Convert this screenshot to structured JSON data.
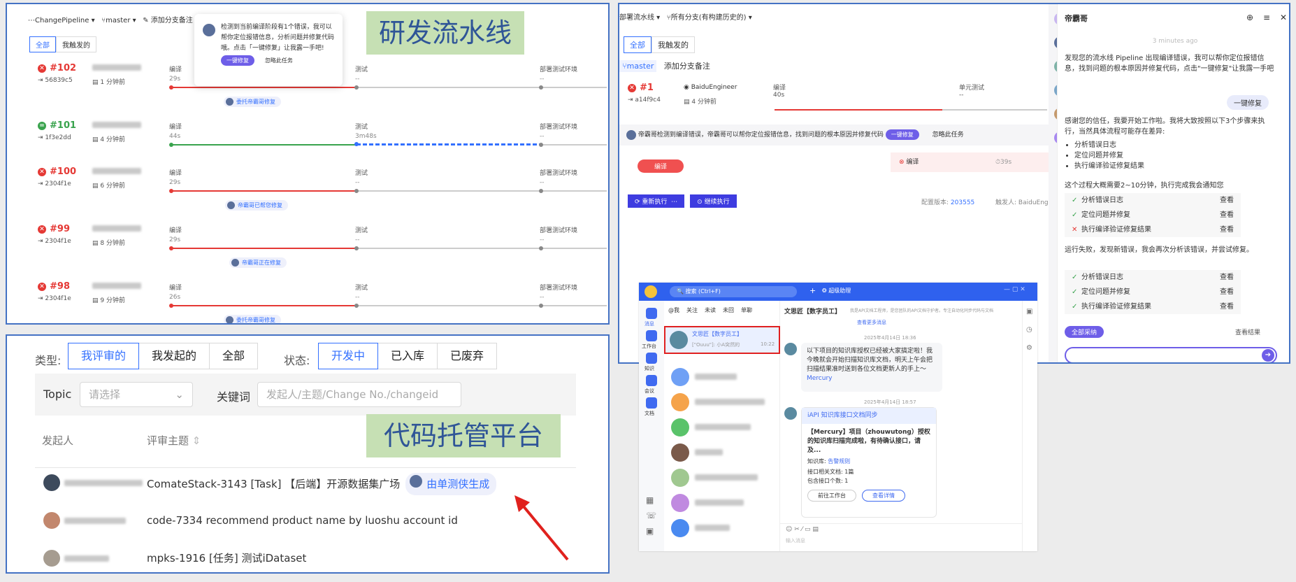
{
  "pipeline_panel": {
    "top_bar": {
      "pipeline": "ChangePipeline",
      "branch": "master",
      "add_note": "添加分支备注"
    },
    "tabs": [
      "全部",
      "我触发的"
    ],
    "popup": {
      "text": "检测到当前编译阶段有1个错误，我可以帮你定位报错信息，分析问题并修复代码哦。点击「一键修复」让我露一手吧!",
      "fix_button": "一键修复",
      "ignore": "忽略此任务"
    },
    "label": "研发流水线",
    "runs": [
      {
        "id": "#102",
        "status": "failed",
        "commit": "56839c5",
        "time": "1 分钟前",
        "stages": [
          {
            "name": "编译",
            "value": "29s"
          },
          {
            "name": "测试",
            "value": "--"
          },
          {
            "name": "部署测试环境",
            "value": "--"
          }
        ],
        "pill": "委托帝霸哥修复"
      },
      {
        "id": "#101",
        "status": "success",
        "commit": "1f3e2dd",
        "time": "4 分钟前",
        "stages": [
          {
            "name": "编译",
            "value": "44s"
          },
          {
            "name": "测试",
            "value": "3m48s"
          },
          {
            "name": "部署测试环境",
            "value": "--"
          }
        ],
        "pill": ""
      },
      {
        "id": "#100",
        "status": "failed",
        "commit": "2304f1e",
        "time": "6 分钟前",
        "stages": [
          {
            "name": "编译",
            "value": "29s"
          },
          {
            "name": "测试",
            "value": "--"
          },
          {
            "name": "部署测试环境",
            "value": "--"
          }
        ],
        "pill": "帝霸哥已帮您修复"
      },
      {
        "id": "#99",
        "status": "failed",
        "commit": "2304f1e",
        "time": "8 分钟前",
        "stages": [
          {
            "name": "编译",
            "value": "29s"
          },
          {
            "name": "测试",
            "value": "--"
          },
          {
            "name": "部署测试环境",
            "value": "--"
          }
        ],
        "pill": "帝霸哥正在修复"
      },
      {
        "id": "#98",
        "status": "failed",
        "commit": "2304f1e",
        "time": "9 分钟前",
        "stages": [
          {
            "name": "编译",
            "value": "26s"
          },
          {
            "name": "测试",
            "value": "--"
          },
          {
            "name": "部署测试环境",
            "value": "--"
          }
        ],
        "pill": "委托帝霸哥修复"
      }
    ]
  },
  "review_panel": {
    "type_label": "类型:",
    "type_options": [
      "我评审的",
      "我发起的",
      "全部"
    ],
    "status_label": "状态:",
    "status_options": [
      "开发中",
      "已入库",
      "已废弃"
    ],
    "topic_label": "Topic",
    "topic_placeholder": "请选择",
    "keyword_label": "关键词",
    "keyword_placeholder": "发起人/主题/Change No./changeid",
    "col_initiator": "发起人",
    "col_subject": "评审主题",
    "label": "代码托管平台",
    "rows": [
      {
        "subject": "ComateStack-3143 [Task] 【后端】开源数据集广场",
        "tag": "由单测侠生成"
      },
      {
        "subject": "code-7334 recommend product name by luoshu account id",
        "tag": ""
      },
      {
        "subject": "mpks-1916 [任务] 测试iDataset",
        "tag": ""
      }
    ]
  },
  "agent_panel": {
    "top_bar": {
      "pipeline": "部署流水线",
      "branch_filter": "所有分支(有构建历史的)"
    },
    "tabs": [
      "全部",
      "我触发的"
    ],
    "branch": "master",
    "add_note": "添加分支备注",
    "run": {
      "id": "#1",
      "user": "BaiduEngineer",
      "commit": "a14f9c4",
      "time": "4 分钟前",
      "stage1": "编译",
      "stage1_time": "40s",
      "stage2": "单元测试",
      "stage2_value": "--"
    },
    "notice": "帝霸哥检测到编译错误，帝霸哥可以帮你定位报错信息，找到问题的根本原因并修复代码",
    "notice_fix": "一键修复",
    "notice_ignore": "忽略此任务",
    "compile_chip": "编译",
    "compile_status": "编译",
    "compile_time": "39s",
    "rerun": "重新执行",
    "continue": "继续执行",
    "config_version_label": "配置版本:",
    "config_version": "203555",
    "trigger_label": "触发人:",
    "trigger_user": "BaiduEngine",
    "chat": {
      "name": "帝霸哥",
      "time": "3 minutes ago",
      "msg1": "发现您的流水线 Pipeline 出现编译错误，我可以帮你定位报错信息，找到问题的根本原因并修复代码，点击\"一键修复\"让我露一手吧",
      "fix_button": "一键修复",
      "msg2": "感谢您的信任，我要开始工作啦。我将大致按照以下3个步骤来执行，当然具体流程可能存在差异:",
      "bullets": [
        "分析错误日志",
        "定位问题并修复",
        "执行编译验证修复结果"
      ],
      "msg3": "这个过程大概需要2~10分钟，执行完成我会通知您",
      "check1": [
        {
          "text": "分析错误日志",
          "ok": true
        },
        {
          "text": "定位问题并修复",
          "ok": true
        },
        {
          "text": "执行编译验证修复结果",
          "ok": false
        }
      ],
      "msg4": "运行失败，发现新错误，我会再次分析该错误，并尝试修复。",
      "check2": [
        {
          "text": "分析错误日志",
          "ok": true
        },
        {
          "text": "定位问题并修复",
          "ok": true
        },
        {
          "text": "执行编译验证修复结果",
          "ok": true
        }
      ],
      "see": "查看",
      "adopt_all": "全部采纳",
      "see_result": "查看结果"
    }
  },
  "im_panel": {
    "search": "搜索 (Ctrl+F)",
    "assistant": "超级助理",
    "filters": [
      "@我",
      "关注",
      "未读",
      "未回",
      "单聊"
    ],
    "nav": [
      "消息",
      "工作台",
      "知识",
      "会议",
      "文档"
    ],
    "selected_contact": "文思匠【数字员工】",
    "selected_preview": "[\"Ouuu\"]: 小A突然的",
    "selected_time": "10:22",
    "chat_title": "文思匠【数字员工】",
    "chat_desc": "我是API文档工程师，是您团队的API文档守护者。专注自动化同步代码与文档",
    "view_more": "查看更多消息",
    "date1": "2025年4月14日 18:36",
    "msg1": "以下项目的知识库授权已经被大家搞定啦！我今晚就会开始扫描知识库文档，明天上午会把扫描结果准时送到各位文档更新人的手上～",
    "msg1_author": "Mercury",
    "date2": "2025年4月14日 18:57",
    "card_title": "iAPI 知识库接口文档同步",
    "card_body": "【Mercury】项目（zhouwutong）授权的知识库扫描完成啦，有待确认接口，请及...",
    "kb_label": "知识库:",
    "kb_value": "告警规则",
    "api_docs_label": "接口相关文档:",
    "api_docs_value": "1篇",
    "api_count_label": "包含接口个数:",
    "api_count_value": "1",
    "btn_workbench": "前往工作台",
    "btn_details": "查看详情",
    "input_placeholder": "输入消息"
  }
}
